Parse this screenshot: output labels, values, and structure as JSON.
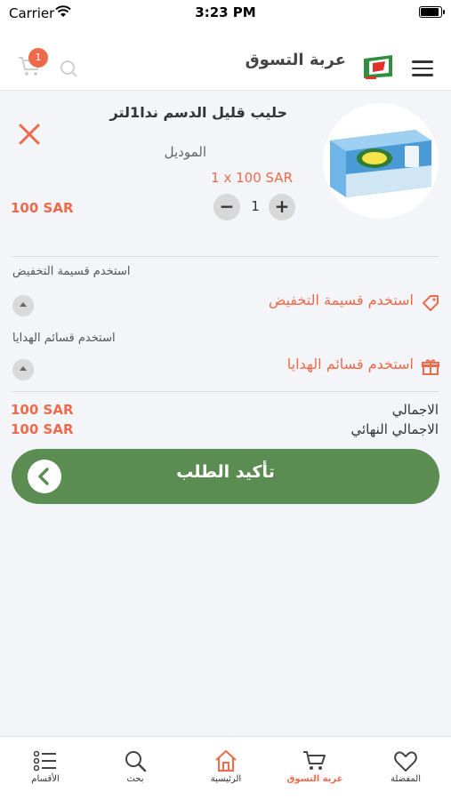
{
  "status_bar": {
    "carrier": "Carrier",
    "time": "3:23 PM",
    "battery_level": 0.95
  },
  "header": {
    "title": "عربة التسوق",
    "cart_badge": "1"
  },
  "cart_item": {
    "name": "حليب قليل الدسم ندا1لتر",
    "model_label": "الموديل",
    "unit_price": "1 x 100 SAR",
    "quantity": "1",
    "total": "100 SAR",
    "minus": "−",
    "plus": "+"
  },
  "coupon": {
    "label": "استخدم قسيمة التخفيض",
    "action": "استخدم قسيمة التخفيض"
  },
  "gift": {
    "label": "استخدم قسائم الهدايا",
    "action": "استخدم قسائم الهدايا"
  },
  "summary": {
    "total_label": "الاجمالي",
    "total_value": "100 SAR",
    "final_label": "الاجمالي النهائي",
    "final_value": "100 SAR"
  },
  "confirm_button": "تأكيد الطلب",
  "tabs": [
    {
      "label": "المفضلة",
      "icon": "heart-icon"
    },
    {
      "label": "عربة التسوق",
      "icon": "cart-icon"
    },
    {
      "label": "الرئيسية",
      "icon": "home-icon"
    },
    {
      "label": "بحث",
      "icon": "search-icon"
    },
    {
      "label": "الأقسام",
      "icon": "categories-icon"
    }
  ],
  "colors": {
    "accent": "#ef6a4a",
    "confirm": "#5b8d53"
  }
}
